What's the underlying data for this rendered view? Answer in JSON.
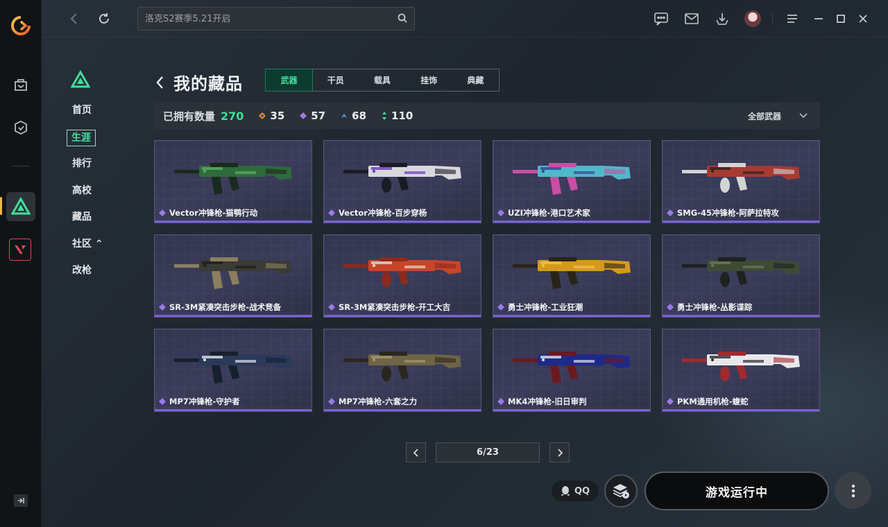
{
  "search": {
    "placeholder": "洛克S2赛季5.21开启"
  },
  "subnav": {
    "items": [
      {
        "label": "首页"
      },
      {
        "label": "生涯"
      },
      {
        "label": "排行"
      },
      {
        "label": "高校"
      },
      {
        "label": "藏品"
      },
      {
        "label": "社区 ⌃"
      },
      {
        "label": "改枪"
      }
    ]
  },
  "page": {
    "title": "我的藏品",
    "tabs": [
      "武器",
      "干员",
      "载具",
      "挂饰",
      "典藏"
    ],
    "active_tab": "武器"
  },
  "stats": {
    "owned_label": "已拥有数量",
    "owned_count": "270",
    "rarity_counts": [
      {
        "value": "35",
        "color": "#e08a3a"
      },
      {
        "value": "57",
        "color": "#9b7ae8"
      },
      {
        "value": "68",
        "color": "#4f9ee6"
      },
      {
        "value": "110",
        "color": "#3fe09a"
      }
    ],
    "filter_label": "全部武器"
  },
  "items": [
    {
      "name": "Vector冲锋枪-猫鹗行动",
      "colors": [
        "#2f6a3c",
        "#1a2a1e",
        "#5fae63"
      ]
    },
    {
      "name": "Vector冲锋枪-百步穿杨",
      "colors": [
        "#d8d8dc",
        "#1b1b24",
        "#6a39b8"
      ]
    },
    {
      "name": "UZI冲锋枪-港口艺术家",
      "colors": [
        "#4fb9c9",
        "#c74fa3",
        "#3a3f8e"
      ]
    },
    {
      "name": "SMG-45冲锋枪-阿萨拉特攻",
      "colors": [
        "#a83a32",
        "#d4d4d4",
        "#2a2222"
      ]
    },
    {
      "name": "SR-3M紧凑突击步枪-战术竞备",
      "colors": [
        "#3a3a36",
        "#8c7e5e",
        "#1e1e1c"
      ]
    },
    {
      "name": "SR-3M紧凑突击步枪-开工大吉",
      "colors": [
        "#c8452a",
        "#8c2a1e",
        "#e2d8c8"
      ]
    },
    {
      "name": "勇士冲锋枪-工业狂潮",
      "colors": [
        "#d49a1e",
        "#2a2418",
        "#f0c24a"
      ]
    },
    {
      "name": "勇士冲锋枪-丛影谍踪",
      "colors": [
        "#3e4a36",
        "#1e2220",
        "#6a7a56"
      ]
    },
    {
      "name": "MP7冲锋枪-守护者",
      "colors": [
        "#2a3a5a",
        "#16202e",
        "#dfe3ea"
      ]
    },
    {
      "name": "MP7冲锋枪-六套之力",
      "colors": [
        "#6e6446",
        "#2a2620",
        "#a8986a"
      ]
    },
    {
      "name": "MK4冲锋枪-旧日审判",
      "colors": [
        "#1e2a8a",
        "#6a1a20",
        "#dfe3ea"
      ]
    },
    {
      "name": "PKM通用机枪-蝮蛇",
      "colors": [
        "#e8e8ea",
        "#a02a30",
        "#2a2a2e"
      ]
    }
  ],
  "pager": {
    "current": "6/23"
  },
  "bottom": {
    "qq_label": "QQ",
    "run_label": "游戏运行中"
  },
  "theme": {
    "accent": "#3fe09a",
    "epic": "#7c5fd8",
    "warn": "#e1454f"
  }
}
